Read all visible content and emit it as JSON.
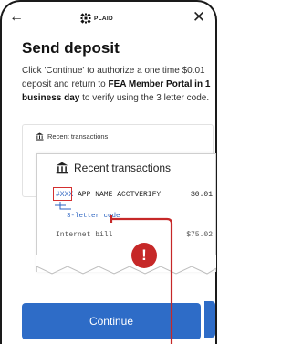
{
  "header": {
    "back_icon": "arrow-left-icon",
    "close_icon": "close-icon",
    "brand": "PLAID"
  },
  "main": {
    "title": "Send deposit",
    "description_1": "Click 'Continue' to authorize a one time $0.01 deposit and return to ",
    "description_bold_1": "FEA Member Portal in 1 business day",
    "description_2": " to verify using the 3 letter code.",
    "card_label": "Recent transactions",
    "continue_label": "Continue"
  },
  "zoom": {
    "header": "Recent transactions",
    "transactions": [
      {
        "code": "#XXX",
        "name": " APP NAME ACCTVERIFY",
        "amount": "$0.01"
      },
      {
        "name": "Internet bill",
        "amount": "$75.02"
      }
    ],
    "annotation": "3-letter code"
  },
  "colors": {
    "accent": "#2e6cc7",
    "warning": "#c62828",
    "code_text": "#2b63c1",
    "highlight_box": "#d32f2f"
  },
  "icons": {
    "warning": "exclamation-icon",
    "bank": "bank-icon",
    "logo": "plaid-logo-icon"
  },
  "warning_glyph": "!"
}
